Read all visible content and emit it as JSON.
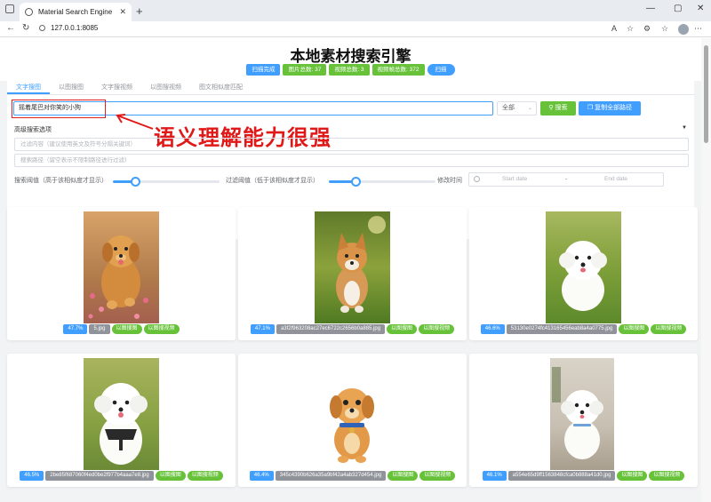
{
  "browser": {
    "tab_title": "Material Search Engine",
    "url": "127.0.0.1:8085"
  },
  "header": {
    "title": "本地素材搜索引擎",
    "badges": {
      "status": "扫描完成",
      "image_count": "图片总数: 37",
      "video_count": "视频总数: 3",
      "frame_count": "视频帧总数: 372",
      "scan_button": "扫描"
    }
  },
  "tabs": [
    "文字搜图",
    "以图搜图",
    "文字搜视频",
    "以图搜视频",
    "图文相似度匹配"
  ],
  "search": {
    "query": "摇着尾巴对你笑的小狗",
    "scope": "全部",
    "search_button": "搜索",
    "scan_all_button": "复制全部路径"
  },
  "annotation": "语义理解能力很强",
  "advanced": {
    "title": "高级搜索选项",
    "filter_placeholder": "过滤内容（建议使用英文及符号分隔关键词）",
    "path_placeholder": "搜索路径（留空表示不限制路径进行过滤）",
    "threshold_label": "搜索阈值（高于该相似度才显示）",
    "filter_threshold_label": "过滤阈值（低于该相似度才显示）",
    "threshold_value": 0.11,
    "filter_threshold_value": 0.17,
    "time_label": "修改时间",
    "start_placeholder": "Start date",
    "range_separator": "-",
    "end_placeholder": "End date"
  },
  "results": [
    {
      "score": "47.7%",
      "file": "5.jpg",
      "actions": [
        "以图搜图",
        "以图搜视频"
      ]
    },
    {
      "score": "47.1%",
      "file": "a3f2f963208ac27ec6722c2656b0a885.jpg",
      "actions": [
        "以图搜图",
        "以图搜视频"
      ]
    },
    {
      "score": "46.6%",
      "file": "53130e0274fc413165456eab8a4a0775.jpg",
      "actions": [
        "以图搜图",
        "以图搜视频"
      ]
    },
    {
      "score": "46.5%",
      "file": "2be85f687060f4ed0be2f977b4aaa7e8.jpg",
      "actions": [
        "以图搜图",
        "以图搜视频"
      ]
    },
    {
      "score": "46.4%",
      "file": "345c4390b626a35a9bf42a4ab327d454.jpg",
      "actions": [
        "以图搜图",
        "以图搜视频"
      ]
    },
    {
      "score": "46.1%",
      "file": "a554e65d9ff1563848cfca0b888a41d0.jpg",
      "actions": [
        "以图搜图",
        "以图搜视频"
      ]
    }
  ],
  "colors": {
    "primary": "#409eff",
    "success": "#67c23a",
    "info": "#909399",
    "annotation": "#e01818"
  }
}
